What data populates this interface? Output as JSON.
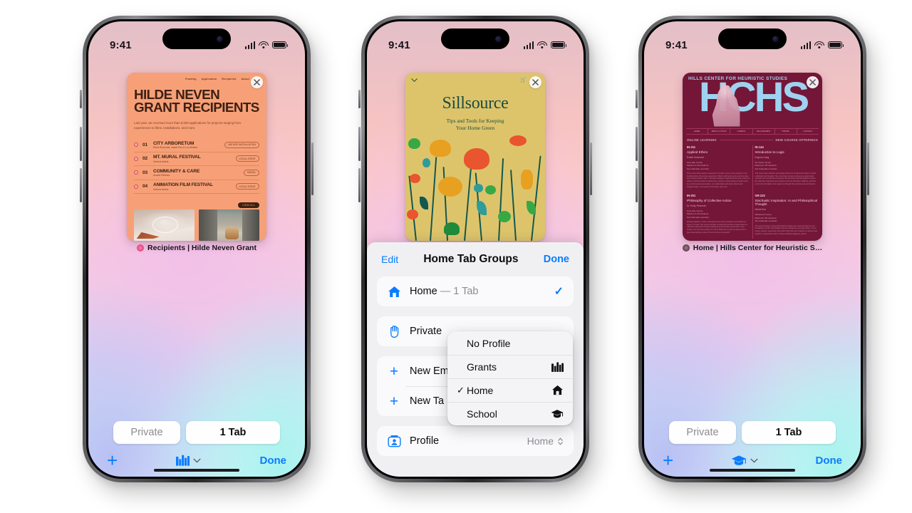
{
  "status_bar": {
    "time": "9:41",
    "cellular": "signal-bars",
    "wifi": "wifi",
    "battery": "battery-full"
  },
  "phones": [
    {
      "id": "phone-1",
      "tab_label": "Recipients | Hilde Neven Grant",
      "card": {
        "type": "hilde-neven-grant",
        "nav": [
          "Funding",
          "Application",
          "Recipients",
          "About"
        ],
        "title_line1": "HILDE NEVEN",
        "title_line2": "GRANT RECIPIENTS",
        "intro": "Last year, we received more than 8,000 applications for projects ranging from experiences to films, installations, and more.",
        "view_all": "VIEW ALL",
        "rows": [
          {
            "num": "01",
            "name": "CITY ARBORETUM",
            "artist": "Rhea Reynolds, Isabel Paz & Lou Belette",
            "tag": "NATURE INSTALLATION"
          },
          {
            "num": "02",
            "name": "MT. MURAL FESTIVAL",
            "artist": "Various Artists",
            "tag": "LOCAL EVENT"
          },
          {
            "num": "03",
            "name": "COMMUNITY & CARE",
            "artist": "Acacia Ramara",
            "tag": "MURAL"
          },
          {
            "num": "04",
            "name": "ANIMATION FILM FESTIVAL",
            "artist": "Various Artists",
            "tag": "LOCAL EVENT"
          }
        ]
      },
      "toolbar": {
        "private_label": "Private",
        "tabs_label": "1 Tab",
        "new_tab_icon": "plus-icon",
        "profile_icon": "books-icon",
        "chevron_icon": "chevron-down-icon",
        "done_label": "Done"
      }
    },
    {
      "id": "phone-2",
      "card": {
        "type": "sillsource",
        "title": "Sillsource",
        "subtitle_line1": "Tips and Tools for Keeping",
        "subtitle_line2": "Your Home Green",
        "chevron_icon": "chevron-down-icon",
        "cart_icon": "cart-icon"
      },
      "sheet": {
        "edit_label": "Edit",
        "title": "Home Tab Groups",
        "done_label": "Done",
        "rows": [
          {
            "name": "home-tab-group-row",
            "icon": "house-icon",
            "label": "Home",
            "suffix": " — 1 Tab",
            "checked": true
          },
          {
            "name": "private-row",
            "icon": "hand-raised-icon",
            "label": "Private",
            "suffix": "",
            "checked": false
          },
          {
            "name": "new-empty-tab-group-row",
            "icon": "plus-icon",
            "label": "New Em",
            "suffix": "",
            "checked": false
          },
          {
            "name": "new-tab-group-row",
            "icon": "plus-icon",
            "label": "New Ta",
            "suffix": "",
            "checked": false
          },
          {
            "name": "profile-row",
            "icon": "profile-icon",
            "label": "Profile",
            "value": "Home",
            "suffix": "",
            "checked": false
          }
        ]
      },
      "context_menu": {
        "items": [
          {
            "label": "No Profile",
            "icon": "",
            "checked": false
          },
          {
            "label": "Grants",
            "icon": "books-icon",
            "checked": false
          },
          {
            "label": "Home",
            "icon": "house-icon",
            "checked": true
          },
          {
            "label": "School",
            "icon": "graduation-cap-icon",
            "checked": false
          }
        ]
      }
    },
    {
      "id": "phone-3",
      "tab_label": "Home | Hills Center for Heuristic S…",
      "card": {
        "type": "hchs",
        "kicker": "HILLS CENTER FOR HEURISTIC STUDIES",
        "wordmark": "HCHS",
        "nav": [
          "HOME",
          "ABOUT & STUDY",
          "CAMPUS",
          "FELLOWSHIPS",
          "PORTAL",
          "CONTACT"
        ],
        "section_left": "ONLINE LEARNING",
        "section_right": "NEW COURSE OFFERINGS",
        "courses": [
          {
            "code": "IN-311",
            "name": "Applied Ethics",
            "instructor": "Evette Horkovich",
            "meta": "Five-day course\nMaximum 40 students\nSet Calendar reminder",
            "body": "This course offers learners essential to consider some of the questions most fundamental to the human experience: What is right and wrong, and how does one choose between them? Through readings in legal discourse and a series of written exercises students will develop a deeper understanding of topics such as environmental preservation, our relationships with those friends and strangers alike, our treatment of animals, and more."
          },
          {
            "code": "IN-144",
            "name": "Introduction to Logic",
            "instructor": "Eugene Liang",
            "meta": "Six-week course\nMaximum 35 students\nSet Calendar reminder",
            "body": "This course also practices and shapes about the fundamental nature in which individuals can thoughts. Here, the study of clear set theory we apply static symbolic and constructed computing. We will study classical logical concepts like deductive reasoning, then advance onto the principles, fallacies, and how we find the formalities of an argument through the premises and conclusions."
          },
          {
            "code": "IN-201",
            "name": "Philosophy of Collective Action",
            "instructor": "Dr. Emily Pedersen",
            "meta": "Four-day course\nMaximum 40 students\nSet Calendar reminder",
            "body": "Working together is often understood as the first essential to accomplish an action or a task. This course will offer an historical overview of past actions in collective leadership through readings and discussions presented in case studies, from how the practice of much? What can we find out about how to group attempting to solve it? And, are they successful?"
          },
          {
            "code": "GR-222",
            "name": "Stochastic Inspiration: AI and Philosophical Thought",
            "instructor": "Nicole Kim",
            "meta": "Weekend course\nMaximum 50 students\nSet Calendar reminder",
            "body": "This seminar takes a close philosophical shape even made through the new foundations and the technologies that are reshaped in everyday ideas. It is an inquiry, practice, generative and public fields that such students to observe that another or what extent ethics of these artificial intelligence stands."
          }
        ]
      },
      "toolbar": {
        "private_label": "Private",
        "tabs_label": "1 Tab",
        "new_tab_icon": "plus-icon",
        "profile_icon": "graduation-cap-icon",
        "chevron_icon": "chevron-down-icon",
        "done_label": "Done"
      }
    }
  ],
  "colors": {
    "accent_blue": "#0a7cff",
    "card1_bg": "#f7a077",
    "card2_bg": "#ddc46b",
    "card3_bg": "#741637",
    "card3_text": "#9ed2f0"
  }
}
